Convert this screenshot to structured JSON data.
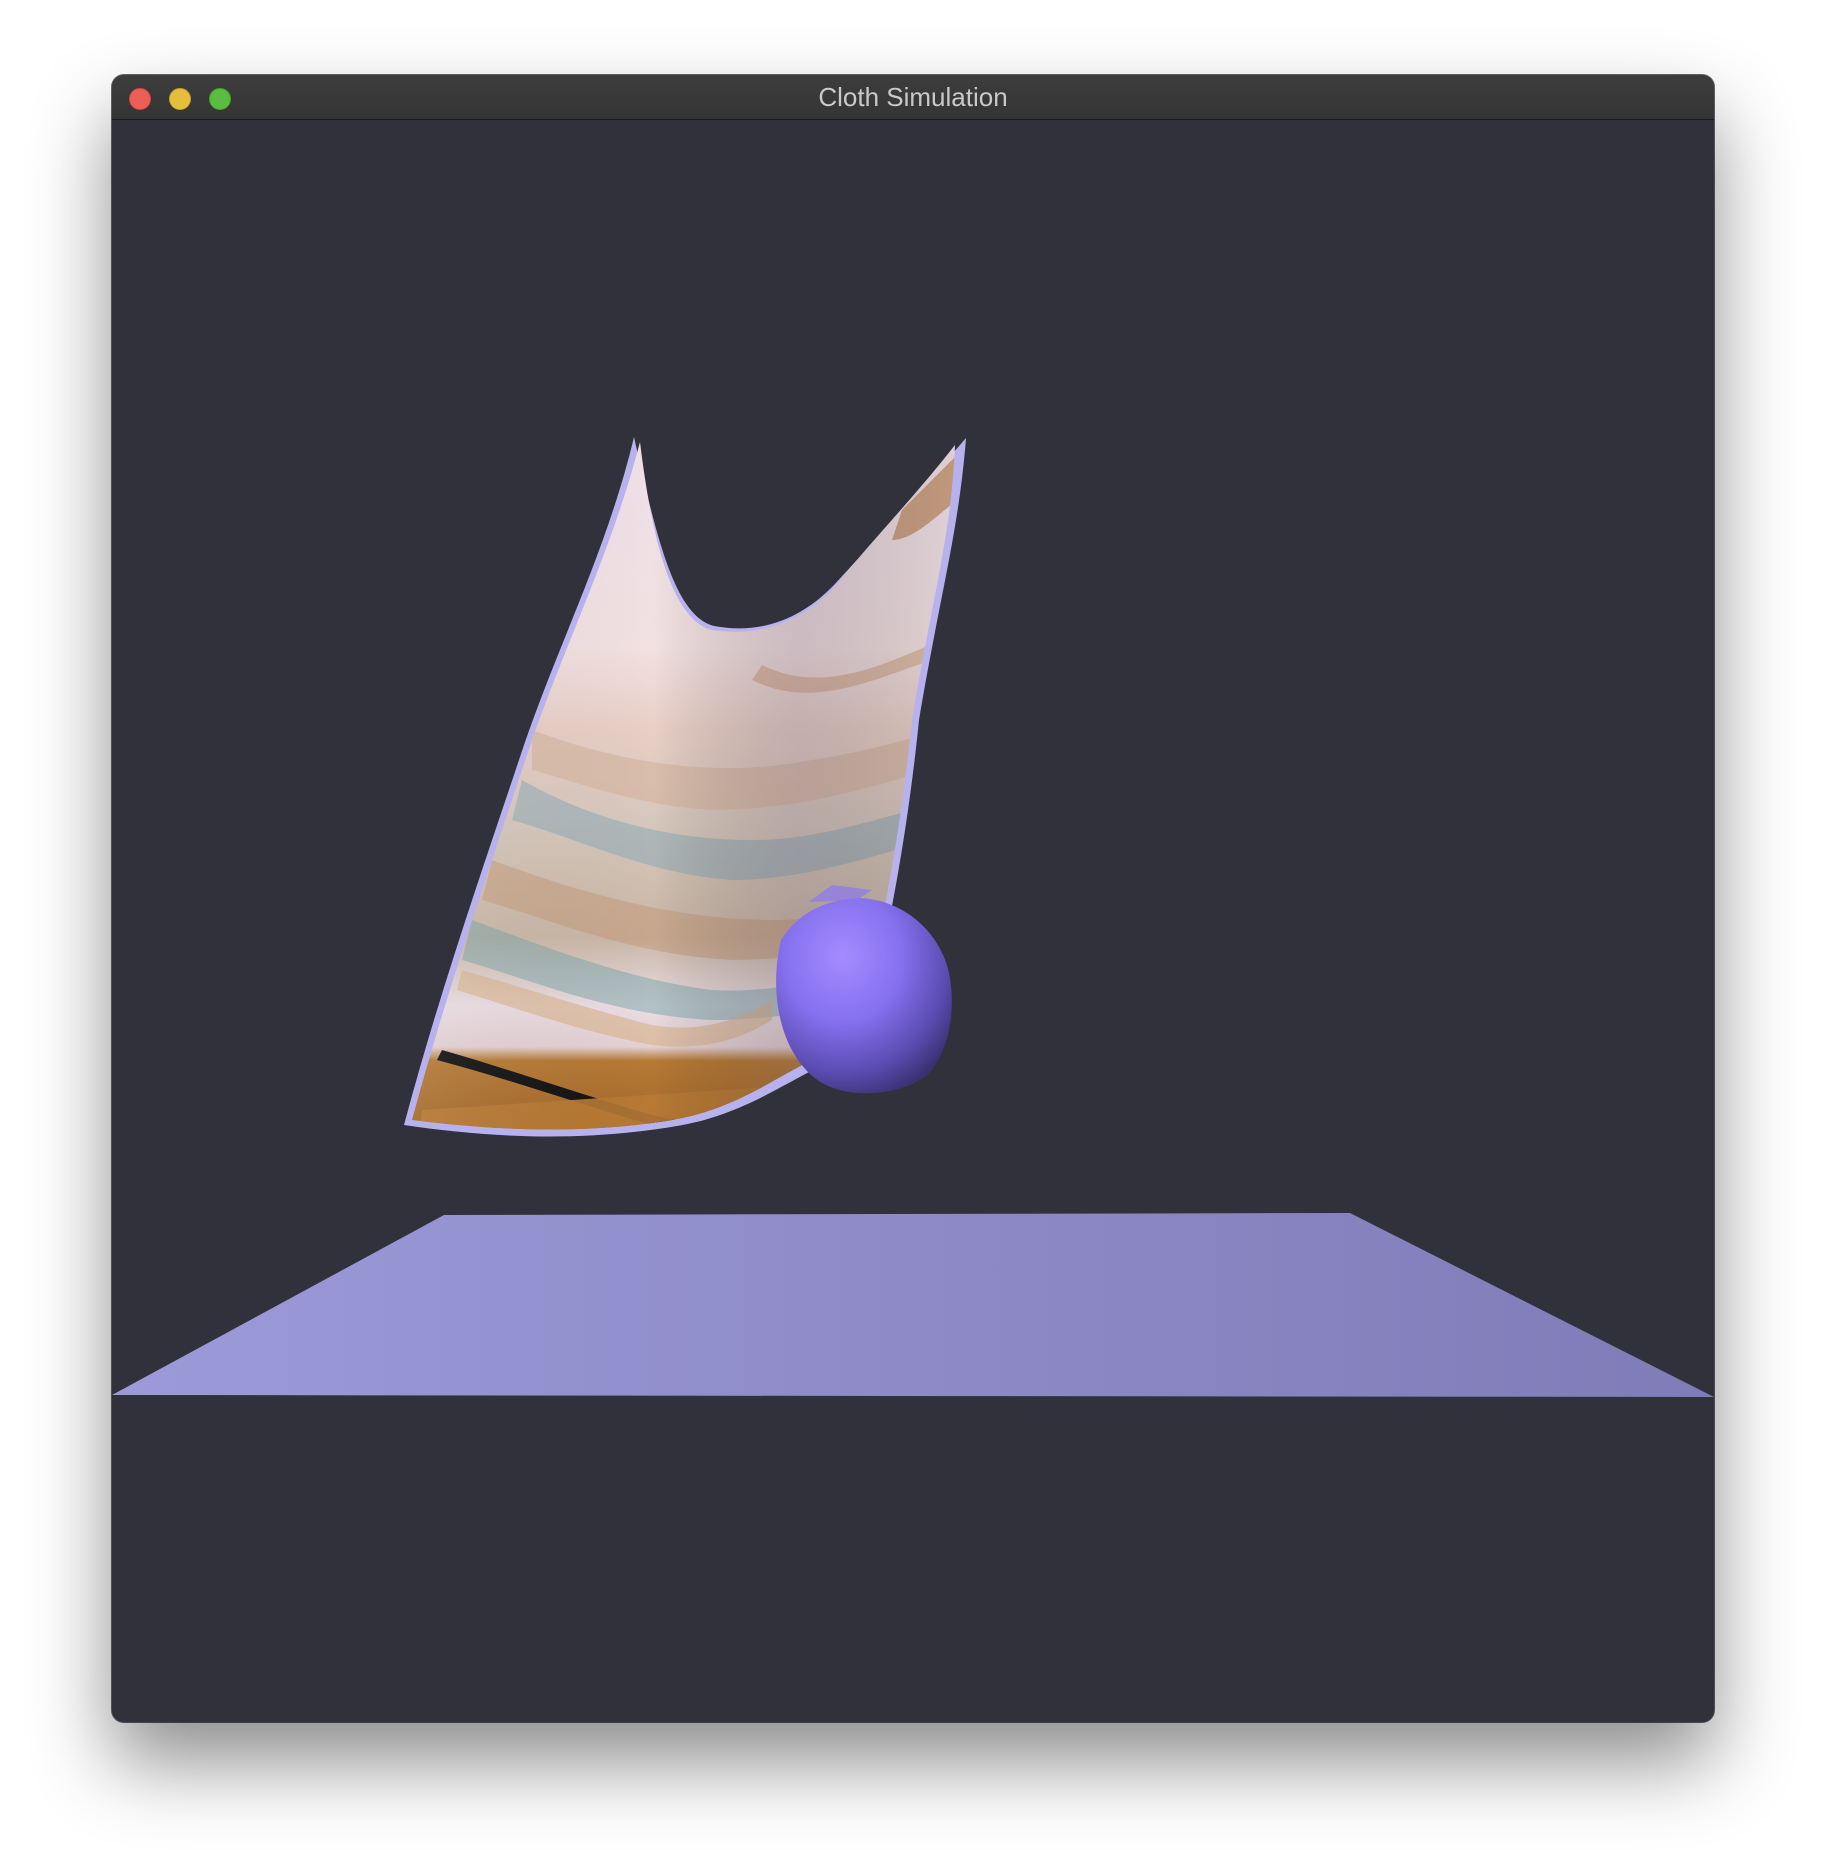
{
  "window": {
    "title": "Cloth Simulation",
    "controls": {
      "close": "close-icon",
      "minimize": "minimize-icon",
      "zoom": "zoom-icon"
    }
  },
  "scene": {
    "background_color": "#31313c",
    "floor_color": "#9a98d6",
    "sphere_color": "#8a78f0",
    "cloth_base_color": "#f0dde3"
  }
}
